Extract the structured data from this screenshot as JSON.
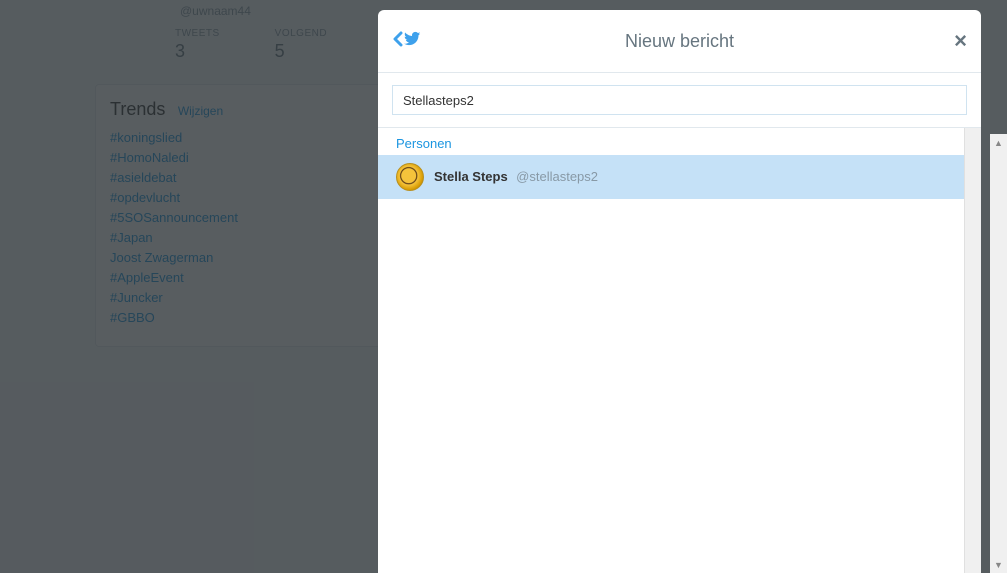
{
  "profile": {
    "handle": "@uwnaam44",
    "stats": {
      "tweets_label": "TWEETS",
      "tweets_value": "3",
      "following_label": "VOLGEND",
      "following_value": "5"
    }
  },
  "trends": {
    "title": "Trends",
    "change_label": "Wijzigen",
    "items": [
      "#koningslied",
      "#HomoNaledi",
      "#asieldebat",
      "#opdevlucht",
      "#5SOSannouncement",
      "#Japan",
      "Joost Zwagerman",
      "#AppleEvent",
      "#Juncker",
      "#GBBO"
    ]
  },
  "modal": {
    "title": "Nieuw bericht",
    "search_value": "Stellasteps2",
    "section_label": "Personen",
    "result": {
      "name": "Stella Steps",
      "handle": "@stellasteps2"
    }
  }
}
